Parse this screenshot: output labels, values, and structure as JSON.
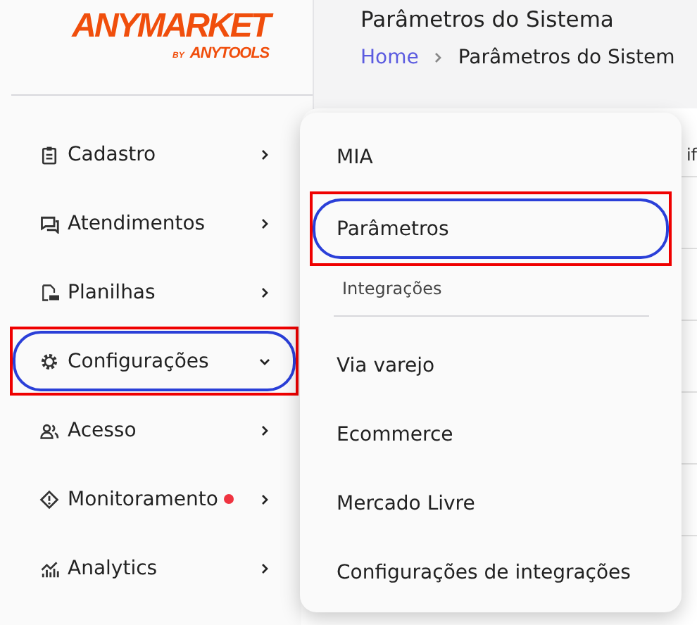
{
  "logo": {
    "brand": "ANYMARKET",
    "by": "BY",
    "maker": "ANYTOOLS"
  },
  "header": {
    "title": "Parâmetros do Sistema",
    "breadcrumb": [
      {
        "label": "Home",
        "link": true
      },
      {
        "label": "Parâmetros do Sistem",
        "link": false
      }
    ]
  },
  "sidebar": {
    "items": [
      {
        "label": "Cadastro",
        "expanded": false,
        "highlighted": false,
        "alert": false
      },
      {
        "label": "Atendimentos",
        "expanded": false,
        "highlighted": false,
        "alert": false
      },
      {
        "label": "Planilhas",
        "expanded": false,
        "highlighted": false,
        "alert": false
      },
      {
        "label": "Configurações",
        "expanded": true,
        "highlighted": true,
        "alert": false
      },
      {
        "label": "Acesso",
        "expanded": false,
        "highlighted": false,
        "alert": false
      },
      {
        "label": "Monitoramento",
        "expanded": false,
        "highlighted": false,
        "alert": true
      },
      {
        "label": "Analytics",
        "expanded": false,
        "highlighted": false,
        "alert": false
      }
    ]
  },
  "background": {
    "fragment": "if"
  },
  "menu": {
    "items": [
      {
        "kind": "item",
        "label": "MIA",
        "highlighted": false
      },
      {
        "kind": "item",
        "label": "Parâmetros",
        "highlighted": true
      },
      {
        "kind": "section",
        "label": "Integrações"
      },
      {
        "kind": "item",
        "label": "Via varejo",
        "highlighted": false
      },
      {
        "kind": "item",
        "label": "Ecommerce",
        "highlighted": false
      },
      {
        "kind": "item",
        "label": "Mercado Livre",
        "highlighted": false
      },
      {
        "kind": "item",
        "label": "Configurações de integrações",
        "highlighted": false
      }
    ]
  }
}
